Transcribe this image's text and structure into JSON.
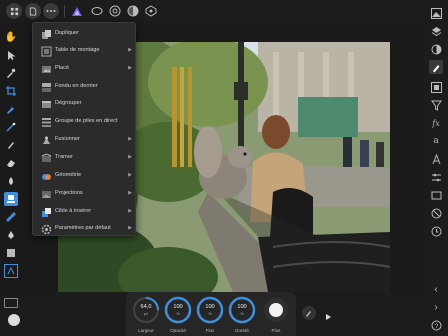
{
  "menu": {
    "items": [
      {
        "label": "Dupliquer",
        "icon": "duplicate-icon",
        "submenu": false
      },
      {
        "label": "Table de montage",
        "icon": "artboard-icon",
        "submenu": true
      },
      {
        "label": "Placé",
        "icon": "place-icon",
        "submenu": true
      },
      {
        "label": "Fondu en dernier",
        "icon": "merge-down-icon",
        "submenu": false
      },
      {
        "label": "Dégrouper",
        "icon": "ungroup-icon",
        "submenu": false
      },
      {
        "label": "Groupe de piles en direct",
        "icon": "live-stack-icon",
        "submenu": false
      },
      {
        "label": "Fusionner",
        "icon": "merge-icon",
        "submenu": true
      },
      {
        "label": "Tramer",
        "icon": "rasterize-icon",
        "submenu": true
      },
      {
        "label": "Géométrie",
        "icon": "geometry-icon",
        "submenu": true
      },
      {
        "label": "Projections",
        "icon": "projection-icon",
        "submenu": true
      },
      {
        "label": "Cible à insérer",
        "icon": "insert-target-icon",
        "submenu": true
      },
      {
        "label": "Paramètres par défaut",
        "icon": "defaults-icon",
        "submenu": true
      }
    ]
  },
  "context": {
    "width": {
      "value": "64,0",
      "unit": "px",
      "label": "Largeur"
    },
    "opacity": {
      "value": "100",
      "unit": "%",
      "label": "Opacité"
    },
    "flow": {
      "value": "100",
      "unit": "%",
      "label": "Flux"
    },
    "hardness": {
      "value": "100",
      "unit": "%",
      "label": "Dureté"
    },
    "more": {
      "label": "Plus"
    }
  },
  "colors": {
    "accent": "#3d8fe0",
    "purple": "#7a5cff",
    "menu_bg": "#2b2b2b"
  }
}
